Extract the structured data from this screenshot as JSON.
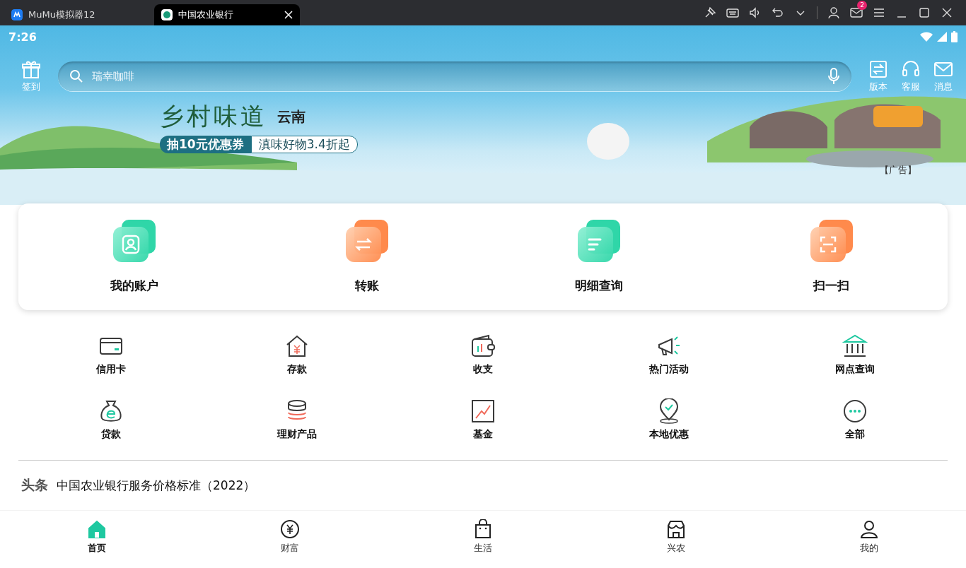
{
  "emulator": {
    "tabs": [
      {
        "label": "MuMu模拟器12",
        "selected": false
      },
      {
        "label": "中国农业银行",
        "selected": true
      }
    ],
    "mail_badge": "2"
  },
  "status_bar": {
    "time": "7:26"
  },
  "header": {
    "checkin": "签到",
    "search": {
      "placeholder": "瑞幸咖啡"
    },
    "actions": [
      {
        "label": "版本",
        "kind": "version"
      },
      {
        "label": "客服",
        "kind": "service"
      },
      {
        "label": "消息",
        "kind": "message"
      }
    ]
  },
  "banner": {
    "title": "乡村味道",
    "region": "云南",
    "coupon": "抽10元优惠券",
    "offer": "滇味好物3.4折起",
    "ad_label": "【广告】"
  },
  "quick_actions": [
    {
      "label": "我的账户",
      "kind": "account"
    },
    {
      "label": "转账",
      "kind": "transfer"
    },
    {
      "label": "明细查询",
      "kind": "details"
    },
    {
      "label": "扫一扫",
      "kind": "scan"
    }
  ],
  "services": [
    {
      "label": "信用卡",
      "kind": "card"
    },
    {
      "label": "存款",
      "kind": "deposit"
    },
    {
      "label": "收支",
      "kind": "wallet"
    },
    {
      "label": "热门活动",
      "kind": "promo"
    },
    {
      "label": "网点查询",
      "kind": "bank"
    },
    {
      "label": "贷款",
      "kind": "loan"
    },
    {
      "label": "理财产品",
      "kind": "coins"
    },
    {
      "label": "基金",
      "kind": "fund"
    },
    {
      "label": "本地优惠",
      "kind": "local"
    },
    {
      "label": "全部",
      "kind": "more"
    }
  ],
  "headline": {
    "tag": "头条",
    "text": "中国农业银行服务价格标准（2022）"
  },
  "bottom_nav": [
    {
      "label": "首页",
      "kind": "home",
      "selected": true
    },
    {
      "label": "财富",
      "kind": "wealth",
      "selected": false
    },
    {
      "label": "生活",
      "kind": "life",
      "selected": false
    },
    {
      "label": "兴农",
      "kind": "farm",
      "selected": false
    },
    {
      "label": "我的",
      "kind": "me",
      "selected": false
    }
  ]
}
